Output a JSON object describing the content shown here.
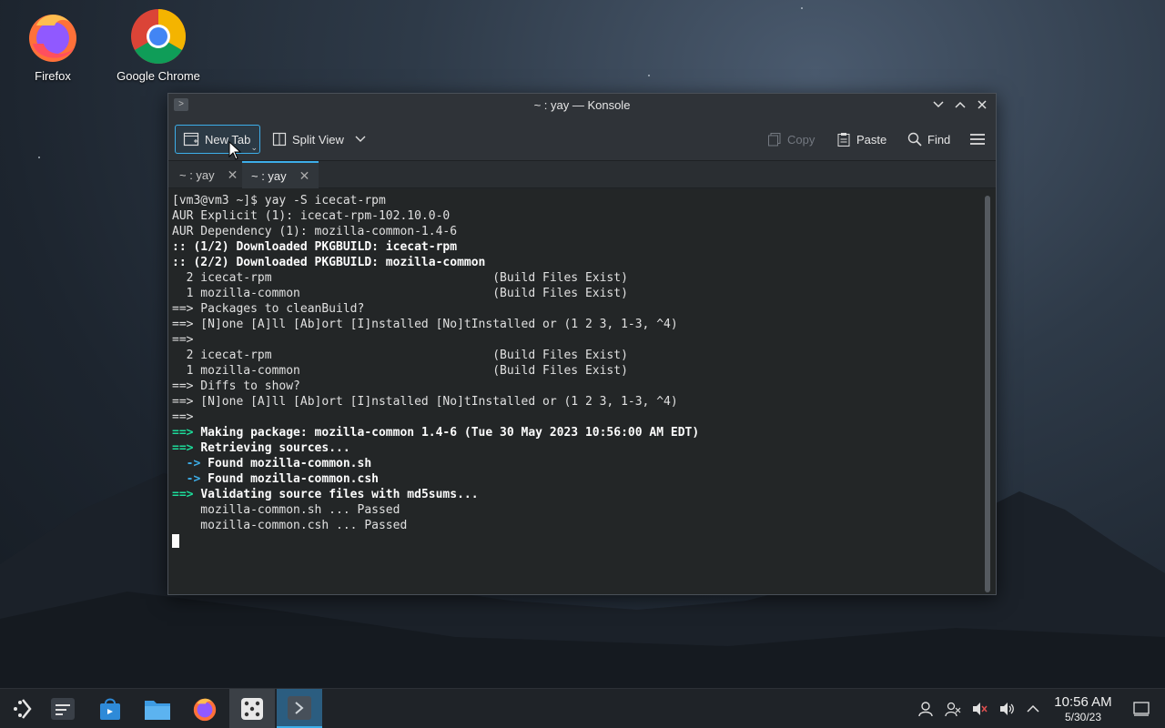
{
  "desktop": {
    "icons": [
      {
        "label": "Firefox",
        "icon": "firefox-icon"
      },
      {
        "label": "Google Chrome",
        "icon": "chrome-icon"
      }
    ]
  },
  "window": {
    "title": "~ : yay — Konsole",
    "toolbar": {
      "new_tab": "New Tab",
      "split_view": "Split View",
      "copy": "Copy",
      "paste": "Paste",
      "find": "Find"
    },
    "tabs": [
      {
        "label": "~ : yay"
      },
      {
        "label": "~ : yay"
      }
    ]
  },
  "terminal": {
    "lines": [
      "[vm3@vm3 ~]$ yay -S icecat-rpm",
      "AUR Explicit (1): icecat-rpm-102.10.0-0",
      "AUR Dependency (1): mozilla-common-1.4-6",
      ":: (1/2) Downloaded PKGBUILD: icecat-rpm",
      ":: (2/2) Downloaded PKGBUILD: mozilla-common",
      "  2 icecat-rpm                               (Build Files Exist)",
      "  1 mozilla-common                           (Build Files Exist)",
      "==> Packages to cleanBuild?",
      "==> [N]one [A]ll [Ab]ort [I]nstalled [No]tInstalled or (1 2 3, 1-3, ^4)",
      "==>",
      "  2 icecat-rpm                               (Build Files Exist)",
      "  1 mozilla-common                           (Build Files Exist)",
      "==> Diffs to show?",
      "==> [N]one [A]ll [Ab]ort [I]nstalled [No]tInstalled or (1 2 3, 1-3, ^4)",
      "==>",
      "Making package: mozilla-common 1.4-6 (Tue 30 May 2023 10:56:00 AM EDT)",
      "Retrieving sources...",
      "Found mozilla-common.sh",
      "Found mozilla-common.csh",
      "Validating source files with md5sums...",
      "    mozilla-common.sh ... Passed",
      "    mozilla-common.csh ... Passed"
    ],
    "green_arrow": "==>",
    "blue_arrow": "->"
  },
  "taskbar": {
    "apps": [
      "app-launcher-icon",
      "overview-icon",
      "discover-store-icon",
      "files-icon",
      "firefox-icon",
      "dice-icon",
      "konsole-icon"
    ],
    "clock_time": "10:56 AM",
    "clock_date": "5/30/23"
  },
  "colors": {
    "accent": "#3daee9",
    "green": "#1cdc9a",
    "terminal_bg": "#232627"
  }
}
